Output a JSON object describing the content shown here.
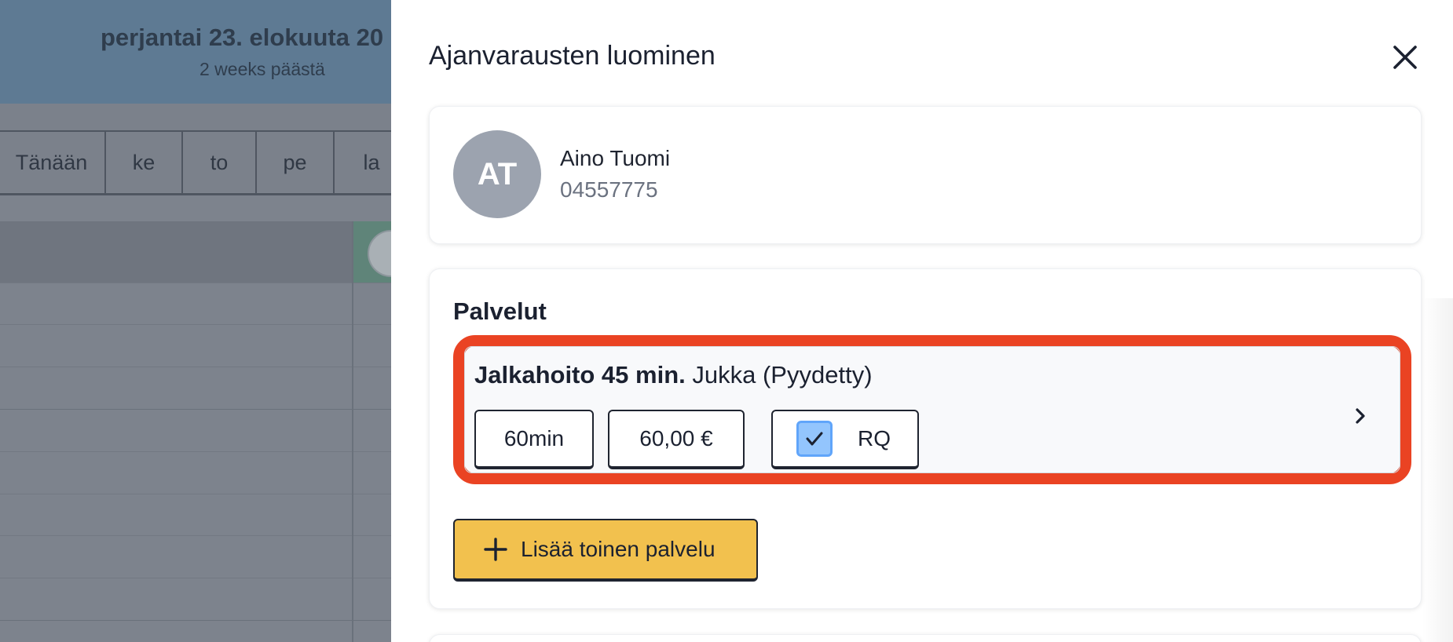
{
  "calendar": {
    "date_heading": "perjantai 23. elokuuta 20",
    "relative_label": "2 weeks päästä",
    "day_tabs": [
      "Tänään",
      "ke",
      "to",
      "pe",
      "la"
    ]
  },
  "drawer": {
    "title": "Ajanvarausten luominen",
    "close_icon": "close-icon"
  },
  "customer": {
    "initials": "AT",
    "name": "Aino Tuomi",
    "phone": "04557775"
  },
  "services": {
    "heading": "Palvelut",
    "items": [
      {
        "name": "Jalkahoito 45 min.",
        "staff": "Jukka (Pyydetty)",
        "duration": "60min",
        "price": "60,00 €",
        "requested_label": "RQ",
        "requested_checked": true
      }
    ],
    "add_button_label": "Lisää toinen palvelu"
  },
  "colors": {
    "highlight_border": "#ea4323",
    "add_button": "#f2c14e",
    "checkbox": "#93c5fd",
    "avatar": "#9ca3af"
  }
}
